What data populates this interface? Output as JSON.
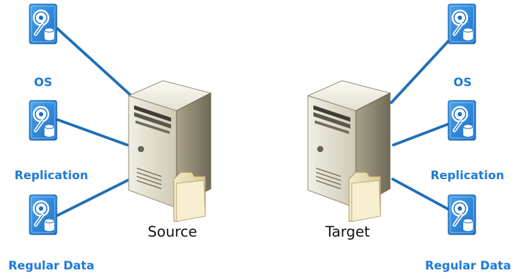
{
  "source": {
    "label": "Source",
    "disks": [
      {
        "label": "OS"
      },
      {
        "label": "Replication"
      },
      {
        "label": "Regular Data"
      }
    ]
  },
  "target": {
    "label": "Target",
    "disks": [
      {
        "label": "OS"
      },
      {
        "label": "Replication"
      },
      {
        "label": "Regular Data"
      }
    ]
  },
  "colors": {
    "connector": "#1f6fb5",
    "disk_body": "#2e8fe6",
    "label_blue": "#1c7ad9",
    "server_light": "#e9e6d8",
    "server_dark": "#8a8570",
    "folder": "#efe2b8"
  },
  "icons": {
    "disk": "hard-disk-icon",
    "server": "tower-server-icon",
    "folder": "folder-icon"
  }
}
